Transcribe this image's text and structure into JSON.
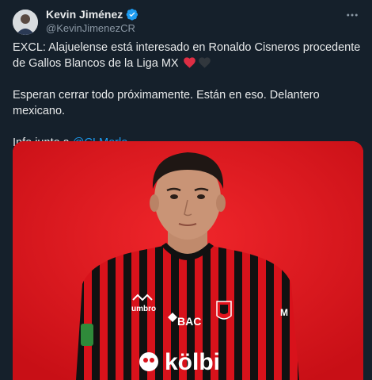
{
  "author": {
    "name": "Kevin Jiménez",
    "handle": "@KevinJimenezCR",
    "verified": true,
    "verified_color": "#1d9bf0"
  },
  "tweet": {
    "line1": "EXCL: Alajuelense está interesado en Ronaldo Cisneros procedente de Gallos Blancos de la Liga MX",
    "hearts": [
      "red-heart-icon",
      "black-heart-icon"
    ],
    "line2": "Esperan cerrar todo próximamente. Están en eso. Delantero mexicano.",
    "line3_prefix": "Info junto a",
    "mention": "@CLMerlo"
  },
  "media": {
    "jersey_texts": {
      "brand": "umbro",
      "bank": "BAC",
      "sponsor": "kölbi"
    },
    "background_color": "#e4131d"
  },
  "more_icon": "more-icon"
}
